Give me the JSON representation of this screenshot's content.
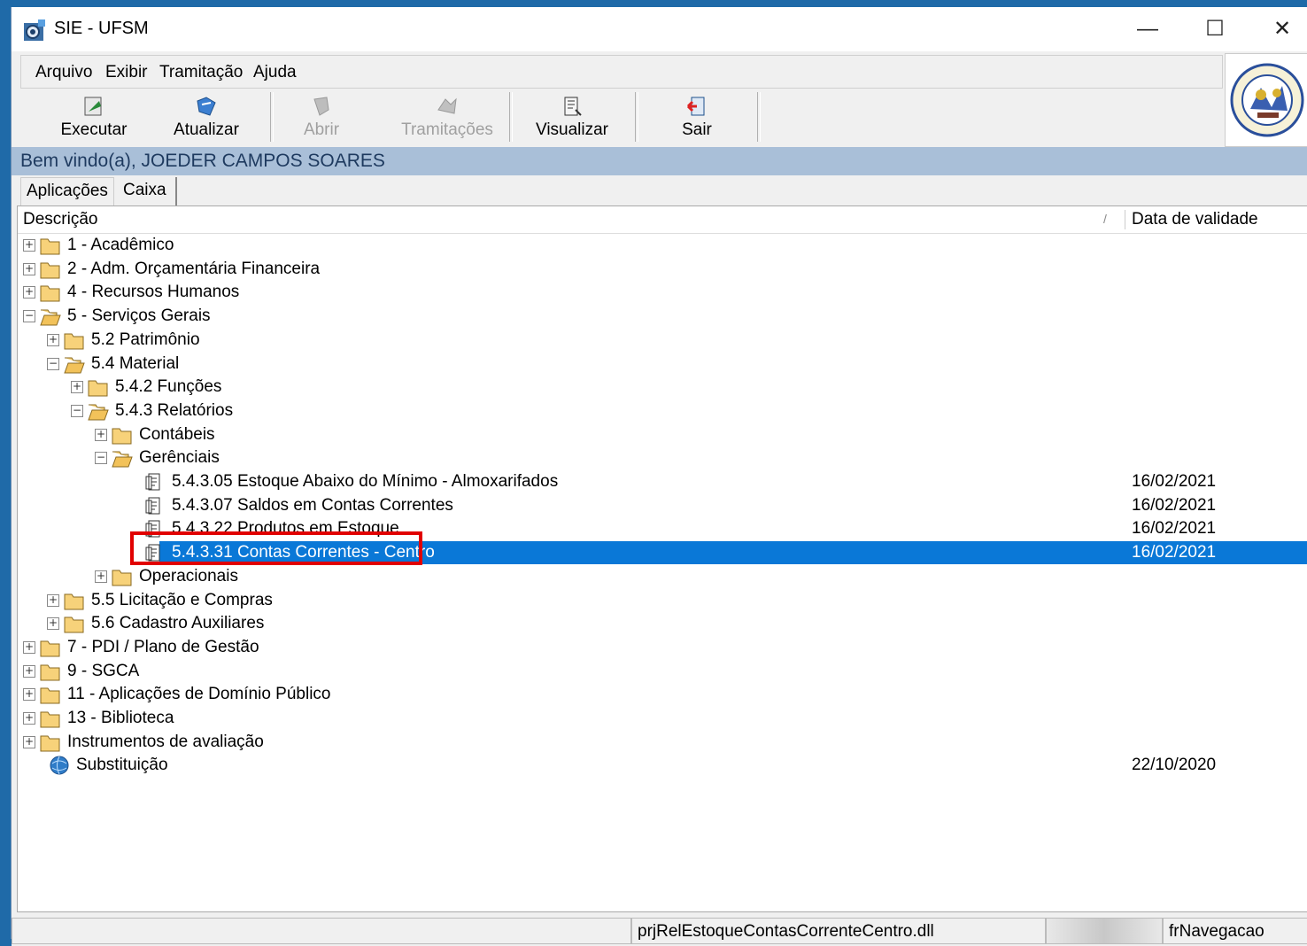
{
  "window": {
    "title": "SIE - UFSM",
    "minimize": "—",
    "maximize": "☐",
    "close": "✕"
  },
  "menu": {
    "items": [
      "Arquivo",
      "Exibir",
      "Tramitação",
      "Ajuda"
    ]
  },
  "toolbar": {
    "buttons": [
      {
        "label": "Executar",
        "icon": "execute-icon",
        "enabled": true
      },
      {
        "label": "Atualizar",
        "icon": "refresh-icon",
        "enabled": true
      },
      {
        "label": "Abrir",
        "icon": "open-icon",
        "enabled": false
      },
      {
        "label": "Tramitações",
        "icon": "transit-icon",
        "enabled": false
      },
      {
        "label": "Visualizar",
        "icon": "view-icon",
        "enabled": true
      },
      {
        "label": "Sair",
        "icon": "exit-icon",
        "enabled": true
      }
    ]
  },
  "welcome": "Bem vindo(a), JOEDER CAMPOS SOARES",
  "tabs": [
    "Aplicações",
    "Caixa Postal"
  ],
  "tree": {
    "columns": {
      "description": "Descrição",
      "sort_glyph": "/",
      "date": "Data de validade"
    },
    "rows": [
      {
        "text": "1 - Acadêmico",
        "level": 0,
        "expander": "+",
        "icon": "folder-icon",
        "date": ""
      },
      {
        "text": "2 - Adm. Orçamentária Financeira",
        "level": 0,
        "expander": "+",
        "icon": "folder-icon",
        "date": ""
      },
      {
        "text": "4 - Recursos Humanos",
        "level": 0,
        "expander": "+",
        "icon": "folder-icon",
        "date": ""
      },
      {
        "text": "5 - Serviços Gerais",
        "level": 0,
        "expander": "−",
        "icon": "folder-open-icon",
        "date": ""
      },
      {
        "text": "5.2 Patrimônio",
        "level": 1,
        "expander": "+",
        "icon": "folder-icon",
        "date": ""
      },
      {
        "text": "5.4 Material",
        "level": 1,
        "expander": "−",
        "icon": "folder-open-icon",
        "date": ""
      },
      {
        "text": "5.4.2 Funções",
        "level": 2,
        "expander": "+",
        "icon": "folder-icon",
        "date": ""
      },
      {
        "text": "5.4.3 Relatórios",
        "level": 2,
        "expander": "−",
        "icon": "folder-open-icon",
        "date": ""
      },
      {
        "text": "Contábeis",
        "level": 3,
        "expander": "+",
        "icon": "folder-icon",
        "date": ""
      },
      {
        "text": "Gerênciais",
        "level": 3,
        "expander": "−",
        "icon": "folder-open-icon",
        "date": ""
      },
      {
        "text": "5.4.3.05 Estoque Abaixo do Mínimo - Almoxarifados",
        "level": 4,
        "expander": "",
        "icon": "report-icon",
        "date": "16/02/2021"
      },
      {
        "text": "5.4.3.07 Saldos em Contas Correntes",
        "level": 4,
        "expander": "",
        "icon": "report-icon",
        "date": "16/02/2021"
      },
      {
        "text": "5.4.3.22 Produtos em Estoque",
        "level": 4,
        "expander": "",
        "icon": "report-icon",
        "date": "16/02/2021"
      },
      {
        "text": "5.4.3.31 Contas Correntes - Centro",
        "level": 4,
        "expander": "",
        "icon": "report-icon",
        "date": "16/02/2021",
        "selected": true
      },
      {
        "text": "Operacionais",
        "level": 3,
        "expander": "+",
        "icon": "folder-icon",
        "date": ""
      },
      {
        "text": "5.5 Licitação e Compras",
        "level": 1,
        "expander": "+",
        "icon": "folder-icon",
        "date": ""
      },
      {
        "text": "5.6 Cadastro Auxiliares",
        "level": 1,
        "expander": "+",
        "icon": "folder-icon",
        "date": ""
      },
      {
        "text": "7 - PDI / Plano de Gestão",
        "level": 0,
        "expander": "+",
        "icon": "folder-icon",
        "date": ""
      },
      {
        "text": "9 - SGCA",
        "level": 0,
        "expander": "+",
        "icon": "folder-icon",
        "date": ""
      },
      {
        "text": "11 - Aplicações de Domínio Público",
        "level": 0,
        "expander": "+",
        "icon": "folder-icon",
        "date": ""
      },
      {
        "text": "13 - Biblioteca",
        "level": 0,
        "expander": "+",
        "icon": "folder-icon",
        "date": ""
      },
      {
        "text": "Instrumentos de avaliação",
        "level": 0,
        "expander": "+",
        "icon": "folder-icon",
        "date": ""
      },
      {
        "text": "Substituição",
        "level": 0,
        "expander": "",
        "icon": "globe-icon",
        "date": "22/10/2020"
      }
    ]
  },
  "status": {
    "dll": "prjRelEstoqueContasCorrenteCentro.dll",
    "form": "frNavegacao"
  },
  "colors": {
    "selection": "#0a78d7",
    "welcome_bar": "#a9bfd8",
    "highlight": "#e10000",
    "desktop": "#1f6aa8"
  }
}
